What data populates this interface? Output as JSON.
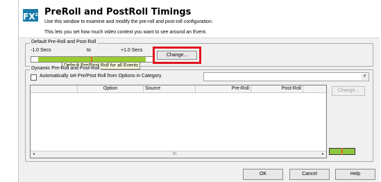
{
  "window": {
    "logo_text": "FX",
    "logo_sup": "2",
    "title": "PreRoll and PostRoll Timings",
    "description_1": "Use this window to examine and modify the pre-roll and post-roll configuration.",
    "description_2": "This lets you set how much video context you want to see around an Event."
  },
  "default_group": {
    "label": "Default Pre-Roll and Post-Roll",
    "min_label": "-1.0 Secs",
    "to_label": "to",
    "max_label": "+1.0 Secs",
    "change_button": "Change...",
    "tooltip": "Default Pre/Post Roll for all Events",
    "highlight_color": "#e0141e",
    "slider_color": "#9acd32",
    "marker_color": "#d86a2a"
  },
  "dynamic_group": {
    "label": "Dynamic Pre-Roll and Post-Roll",
    "auto_checkbox_label": "Automatically set Pre/Post Roll from Options in Category",
    "auto_checked": false,
    "category_value": "",
    "change_button": "Change...",
    "columns": [
      "",
      "Option",
      "Source",
      "Pre-Roll",
      "Post-Roll",
      ""
    ],
    "scroll_left": "◂",
    "scroll_right": "▸",
    "scroll_thumb": "III"
  },
  "footer": {
    "ok": "OK",
    "cancel": "Cancel",
    "help": "Help"
  }
}
